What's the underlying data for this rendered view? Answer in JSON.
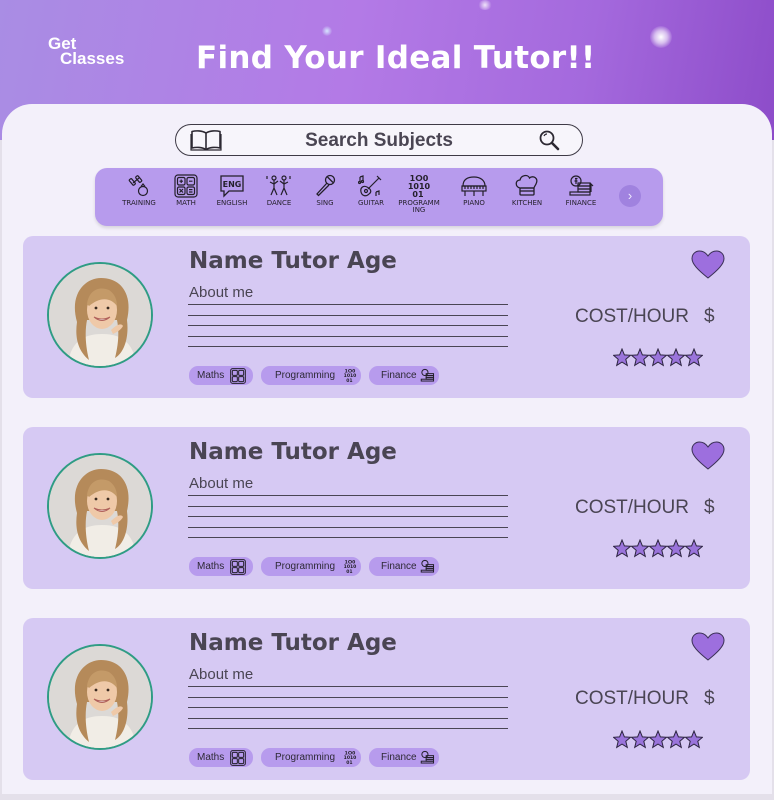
{
  "header": {
    "logo_line1": "Get",
    "logo_line2": "Classes",
    "title": "Find Your Ideal Tutor!!"
  },
  "search": {
    "placeholder": "Search Subjects"
  },
  "categories": [
    {
      "label": "TRAINING",
      "icon": "dumbbell-icon"
    },
    {
      "label": "MATH",
      "icon": "calculator-icon"
    },
    {
      "label": "ENGLISH",
      "icon": "speech-bubble-eng-icon"
    },
    {
      "label": "DANCE",
      "icon": "dancers-icon"
    },
    {
      "label": "SING",
      "icon": "microphone-icon"
    },
    {
      "label": "GUITAR",
      "icon": "guitar-icon"
    },
    {
      "label": "PROGRAMM ING",
      "icon": "binary-icon"
    },
    {
      "label": "PIANO",
      "icon": "piano-icon"
    },
    {
      "label": "KITCHEN",
      "icon": "chef-hat-icon"
    },
    {
      "label": "FINANCE",
      "icon": "coins-icon"
    }
  ],
  "category_next_icon": "chevron-right-icon",
  "tutors": [
    {
      "name": "Name Tutor Age",
      "about": "About me",
      "cost": "COST/HOUR",
      "currency": "$",
      "rating": 5,
      "tags": [
        {
          "label": "Maths",
          "icon": "calculator-icon"
        },
        {
          "label": "Programming",
          "icon": "binary-icon"
        },
        {
          "label": "Finance",
          "icon": "coins-icon"
        }
      ]
    },
    {
      "name": "Name Tutor Age",
      "about": "About me",
      "cost": "COST/HOUR",
      "currency": "$",
      "rating": 5,
      "tags": [
        {
          "label": "Maths",
          "icon": "calculator-icon"
        },
        {
          "label": "Programming",
          "icon": "binary-icon"
        },
        {
          "label": "Finance",
          "icon": "coins-icon"
        }
      ]
    },
    {
      "name": "Name Tutor Age",
      "about": "About me",
      "cost": "COST/HOUR",
      "currency": "$",
      "rating": 5,
      "tags": [
        {
          "label": "Maths",
          "icon": "calculator-icon"
        },
        {
          "label": "Programming",
          "icon": "binary-icon"
        },
        {
          "label": "Finance",
          "icon": "coins-icon"
        }
      ]
    }
  ],
  "colors": {
    "accent": "#b79bed",
    "card": "#d6c9f3",
    "heart": "#9d6fde",
    "star": "#9a74db",
    "text": "#4a4553"
  }
}
